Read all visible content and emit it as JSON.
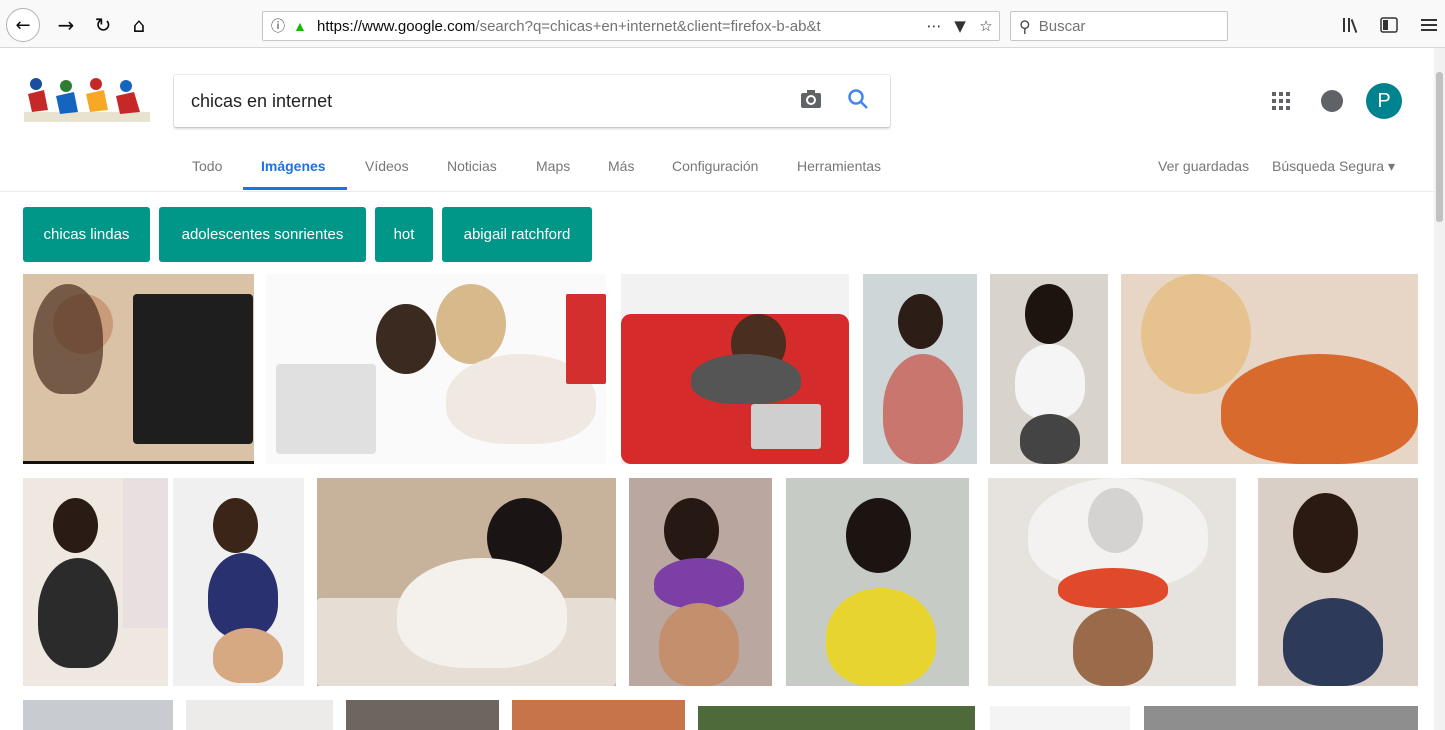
{
  "browser": {
    "url_host": "https://www.google.com",
    "url_rest": "/search?q=chicas+en+internet&client=firefox-b-ab&t",
    "search_placeholder": "Buscar",
    "icons": [
      "back-icon",
      "forward-icon",
      "reload-icon",
      "home-icon",
      "info-icon",
      "lock-icon",
      "more-icon",
      "pocket-icon",
      "bookmark-star-icon",
      "search-icon",
      "library-icon",
      "sidebar-icon",
      "menu-icon"
    ]
  },
  "google": {
    "query": "chicas en internet",
    "avatar_letter": "P",
    "tabs": [
      "Todo",
      "Imágenes",
      "Vídeos",
      "Noticias",
      "Maps",
      "Más",
      "Configuración",
      "Herramientas"
    ],
    "active_tab": "Imágenes",
    "right_links": {
      "saved": "Ver guardadas",
      "safe_search": "Búsqueda Segura ▾"
    },
    "chips": [
      "chicas lindas",
      "adolescentes sonrientes",
      "hot",
      "abigail ratchford"
    ],
    "colors": {
      "chip": "#009688",
      "active_tab": "#1a73e8",
      "avatar": "#00838f"
    }
  }
}
